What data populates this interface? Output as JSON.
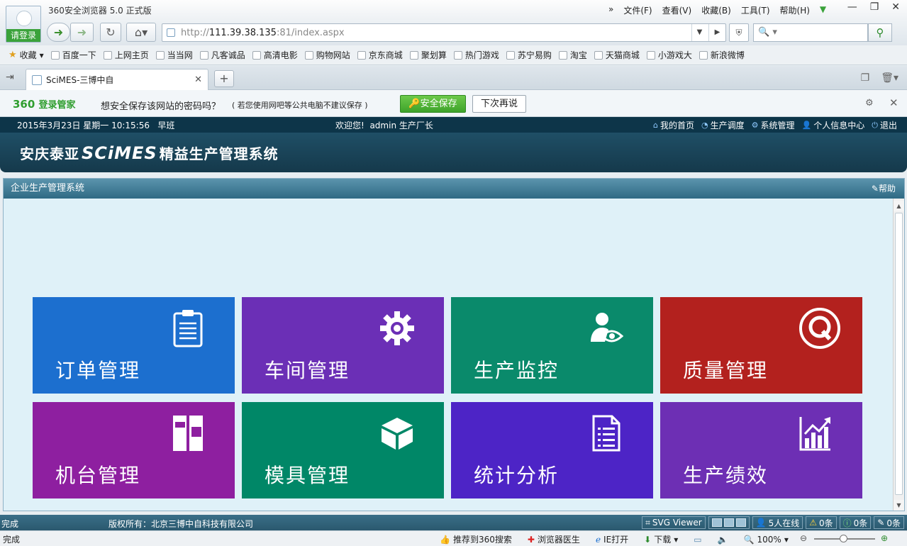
{
  "browser": {
    "title": "360安全浏览器 5.0 正式版",
    "login_label": "请登录",
    "menu": [
      "文件(F)",
      "查看(V)",
      "收藏(B)",
      "工具(T)",
      "帮助(H)"
    ],
    "menu_more": "»",
    "url_prefix": "http://",
    "url_host": "111.39.38.135",
    "url_rest": ":81/index.aspx",
    "search_placeholder": "🔍 ▾",
    "bookmarks_label": "收藏",
    "bookmarks": [
      "百度一下",
      "上网主页",
      "当当网",
      "凡客诚品",
      "高清电影",
      "购物网站",
      "京东商城",
      "聚划算",
      "热门游戏",
      "苏宁易购",
      "淘宝",
      "天猫商城",
      "小游戏大",
      "新浪微博"
    ],
    "tab_title": "SciMES-三博中自",
    "password_bar": {
      "brand_num": "360",
      "brand": "登录管家",
      "question": "想安全保存该网站的密码吗？",
      "hint": "( 若您使用网吧等公共电脑不建议保存 )",
      "save": "安全保存",
      "later": "下次再说"
    }
  },
  "app": {
    "datetime": "2015年3月23日  星期一  10:15:56",
    "shift": "早班",
    "welcome": "欢迎您!",
    "user": "admin 生产厂长",
    "nav": [
      "我的首页",
      "生产调度",
      "系统管理",
      "个人信息中心",
      "退出"
    ],
    "logo_left": "安庆泰亚",
    "logo_mid": "SCiMES",
    "logo_right": "精益生产管理系统",
    "panel_title": "企业生产管理系统",
    "help": "帮助",
    "tiles": [
      {
        "label": "订单管理",
        "color": "#1c6fcf",
        "icon": "clipboard-icon"
      },
      {
        "label": "车间管理",
        "color": "#6b2fb6",
        "icon": "gear-icon"
      },
      {
        "label": "生产监控",
        "color": "#0a8a6b",
        "icon": "person-eye-icon"
      },
      {
        "label": "质量管理",
        "color": "#b3211e",
        "icon": "quality-q-icon"
      },
      {
        "label": "机台管理",
        "color": "#8e1fa0",
        "icon": "machine-panel-icon"
      },
      {
        "label": "模具管理",
        "color": "#008767",
        "icon": "cube-icon"
      },
      {
        "label": "统计分析",
        "color": "#4d24c6",
        "icon": "document-icon"
      },
      {
        "label": "生产绩效",
        "color": "#6d2fb4",
        "icon": "bar-chart-icon"
      }
    ]
  },
  "status": {
    "done": "完成",
    "copyright": "版权所有：北京三博中自科技有限公司",
    "svg_viewer": "SVG Viewer",
    "online": "5人在线",
    "warn_count": "0条",
    "info_count": "0条",
    "tool_count": "0条",
    "bottom_done": "完成",
    "recommend": "推荐到360搜索",
    "doctor": "浏览器医生",
    "ie_open": "IE打开",
    "download": "下载",
    "zoom": "100%"
  }
}
